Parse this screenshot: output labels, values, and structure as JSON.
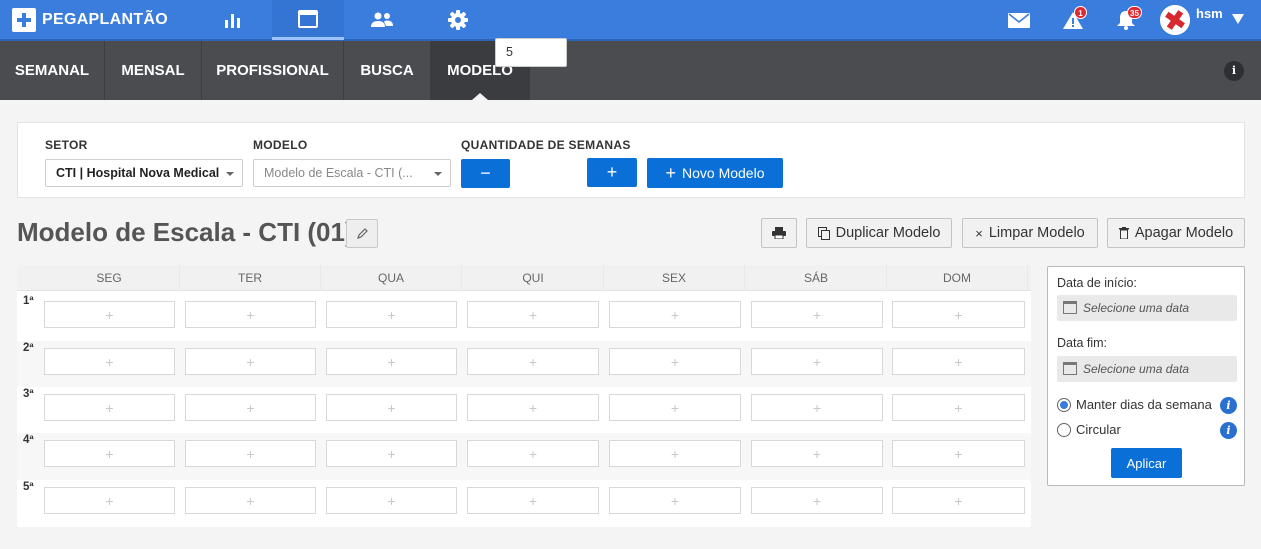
{
  "app": {
    "name": "PEGAPLANTÃO"
  },
  "topnav": {
    "icons": [
      "bar-chart-icon",
      "calendar-icon",
      "users-icon",
      "gear-icon"
    ],
    "alerts_badge": "1",
    "notifications_badge": "35",
    "user": "hsm"
  },
  "tabs": [
    {
      "label": "SEMANAL"
    },
    {
      "label": "MENSAL"
    },
    {
      "label": "PROFISSIONAL"
    },
    {
      "label": "BUSCA"
    },
    {
      "label": "MODELO",
      "active": true
    }
  ],
  "filters": {
    "setor_label": "SETOR",
    "setor_value": "CTI | Hospital Nova Medical",
    "modelo_label": "MODELO",
    "modelo_value": "Modelo de Escala - CTI (...",
    "semanas_label": "QUANTIDADE DE SEMANAS",
    "semanas_value": "5",
    "minus": "−",
    "plus": "+",
    "novo_modelo": "Novo Modelo"
  },
  "page": {
    "title": "Modelo de Escala - CTI (01)",
    "duplicar": "Duplicar Modelo",
    "limpar": "Limpar Modelo",
    "apagar": "Apagar Modelo"
  },
  "grid": {
    "days": [
      "SEG",
      "TER",
      "QUA",
      "QUI",
      "SEX",
      "SÁB",
      "DOM"
    ],
    "weeks": [
      "1ª",
      "2ª",
      "3ª",
      "4ª",
      "5ª"
    ],
    "cell_placeholder": "+"
  },
  "side": {
    "inicio_label": "Data de início:",
    "inicio_placeholder": "Selecione uma data",
    "fim_label": "Data fim:",
    "fim_placeholder": "Selecione uma data",
    "option1": "Manter dias da semana",
    "option2": "Circular",
    "apply": "Aplicar"
  },
  "colors": {
    "primary": "#3b7ddd",
    "button": "#0a6fd6",
    "subnav": "#4a4c50",
    "badge": "#e0282e"
  }
}
